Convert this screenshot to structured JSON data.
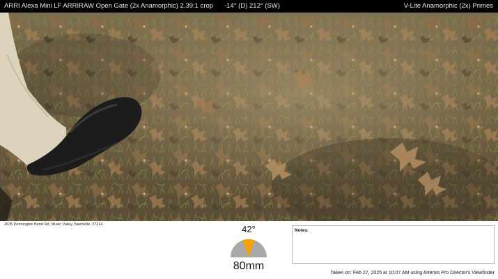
{
  "header": {
    "camera": "ARRI Alexa Mini LF ARRIRAW Open Gate (2x Anamorphic) 2.39:1 crop",
    "orientation": "-14° (D) 212° (SW)",
    "lens": "V-Lite Anamorphic (2x) Primes"
  },
  "footer": {
    "address": "2635 Pennington Bend Rd, Music Valley, Nashville, 37214",
    "angle": "42°",
    "focal_length": "80mm",
    "notes_label": "Notes:",
    "notes_value": "",
    "taken_on": "Taken on: Feb 27, 2025 at 10:07 AM using Artemis Pro Director's Viewfinder"
  },
  "colors": {
    "bar": "#000000",
    "gauge_fill": "#a9a9a9",
    "gauge_accent": "#f5a300"
  },
  "icons": {
    "gauge": "field-of-view-gauge-icon"
  }
}
